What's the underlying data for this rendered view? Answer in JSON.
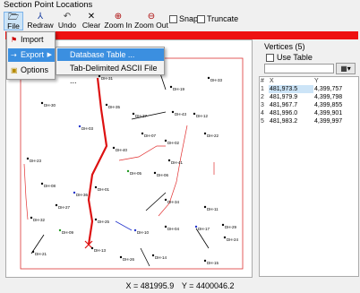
{
  "window": {
    "title": "Section Point Locations"
  },
  "toolbar": {
    "file": "File",
    "redraw": "Redraw",
    "undo": "Undo",
    "clear": "Clear",
    "zoom_in": "Zoom In",
    "zoom_out": "Zoom Out",
    "snap": "Snap",
    "truncate": "Truncate"
  },
  "file_menu": {
    "import": "Import",
    "export": "Export",
    "options": "Options"
  },
  "export_submenu": {
    "database_table": "Database Table ...",
    "tab_delimited": "Tab-Delimited ASCII File ..."
  },
  "colors": {
    "accent_bar": "#ee1111",
    "selection": "#3b8fe0",
    "section_line": "#dd1111",
    "boundary": "#dd3333"
  },
  "vertices_panel": {
    "title": "Vertices (5)",
    "use_table": "Use Table",
    "columns": [
      "#",
      "X",
      "Y"
    ],
    "rows": [
      [
        "1",
        "481,973.5",
        "4,399,757"
      ],
      [
        "2",
        "481,979.9",
        "4,399,798"
      ],
      [
        "3",
        "481,967.7",
        "4,399,855"
      ],
      [
        "4",
        "481,996.0",
        "4,399,901"
      ],
      [
        "5",
        "481,983.2",
        "4,399,997"
      ]
    ]
  },
  "status": {
    "x_label": "X = 481995.9",
    "y_label": "Y = 4400046.2"
  },
  "drillholes": [
    "DH-28",
    "DH-31",
    "DH-19",
    "DH-33",
    "DH-30",
    "DH-35",
    "DH-37",
    "DH-43",
    "DH-12",
    "DH-03",
    "DH-07",
    "DH-02",
    "DH-22",
    "DH-40",
    "DH-41",
    "DH-23",
    "DH-05",
    "DH-06",
    "DH-08",
    "DH-01",
    "DH-36",
    "DH-34",
    "DH-27",
    "DH-11",
    "DH-32",
    "DH-25",
    "DH-29",
    "DH-09",
    "DH-10",
    "DH-04",
    "DH-17",
    "DH-24",
    "DH-21",
    "DH-13",
    "DH-26",
    "DH-14",
    "DH-15"
  ]
}
